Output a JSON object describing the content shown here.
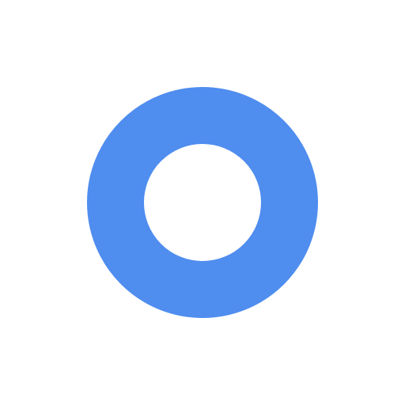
{
  "icon": {
    "name": "ring-icon",
    "color": "#4f8def",
    "background": "#ffffff"
  }
}
